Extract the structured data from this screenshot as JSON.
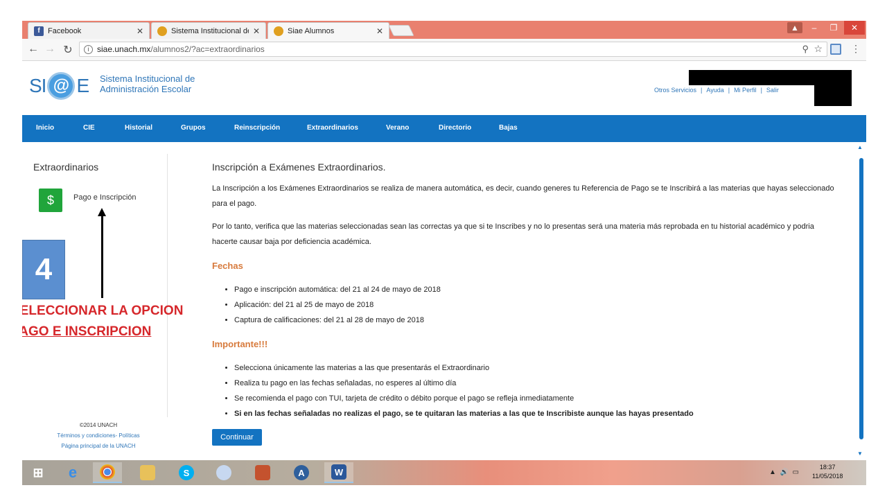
{
  "browser": {
    "tabs": [
      {
        "title": "Facebook",
        "icon": "facebook-icon"
      },
      {
        "title": "Sistema Institucional de A",
        "icon": "unach-icon"
      },
      {
        "title": "Siae Alumnos",
        "icon": "unach-icon"
      }
    ],
    "address": {
      "host": "siae.unach.mx",
      "path": "/alumnos2/?ac=extraordinarios"
    }
  },
  "header": {
    "logo_si": "SI",
    "logo_at": "@",
    "logo_e": "E",
    "logo_line1": "Sistema Institucional de",
    "logo_line2": "Administración Escolar",
    "links": [
      "Otros Servicios",
      "Ayuda",
      "Mi Perfil",
      "Salir"
    ]
  },
  "nav": {
    "items": [
      "Inicio",
      "CIE",
      "Historial",
      "Grupos",
      "Reinscripción",
      "Extraordinarios",
      "Verano",
      "Directorio",
      "Bajas"
    ]
  },
  "sidebar": {
    "title": "Extraordinarios",
    "button_symbol": "$",
    "link": "Pago e Inscripción",
    "footer": {
      "copyright": "©2014 UNACH",
      "terms": "Términos y condiciones- Políticas",
      "home": "Página principal de la UNACH"
    }
  },
  "main": {
    "title": "Inscripción a Exámenes Extraordinarios.",
    "p1": "La Inscripción a los Exámenes Extraordinarios se realiza de manera automática, es decir, cuando generes tu Referencia de Pago se te Inscribirá a las materias que hayas seleccionado para el pago.",
    "p2": "Por lo tanto, verifica que las materias seleccionadas sean las correctas ya que si te Inscribes y no lo presentas será una materia más reprobada en tu historial académico y podria hacerte causar baja por deficiencia académica.",
    "fechas_title": "Fechas",
    "fechas": [
      "Pago e inscripción automática: del 21 al 24 de mayo de 2018",
      "Aplicación: del 21 al 25 de mayo de 2018",
      "Captura de calificaciones: del 21 al 28 de mayo de 2018"
    ],
    "importante_title": "Importante!!!",
    "importante": [
      "Selecciona únicamente las materias a las que presentarás el Extraordinario",
      "Realiza tu pago en las fechas señaladas, no esperes al último día",
      "Se recomienda el pago con TUI, tarjeta de crédito o débito porque el pago se refleja inmediatamente",
      "Si en las fechas señaladas no realizas el pago, se te quitaran las materias a las que te Inscribiste aunque las hayas presentado"
    ],
    "button": "Continuar"
  },
  "annotation": {
    "step": "4",
    "line1": "SELECCIONAR LA OPCION",
    "line2": "PAGO E INSCRIPCION"
  },
  "taskbar": {
    "apps": [
      "start-icon",
      "ie-icon",
      "chrome-icon",
      "file-explorer-icon",
      "skype-icon",
      "paint-icon",
      "game-icon",
      "app-icon",
      "word-icon"
    ],
    "time": "18:37",
    "date": "11/05/2018"
  }
}
